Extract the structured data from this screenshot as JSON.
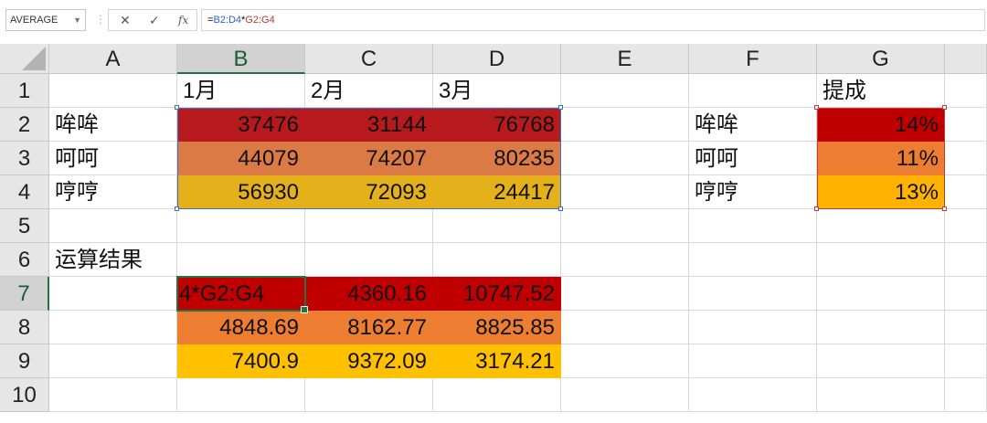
{
  "name_box": {
    "value": "AVERAGE"
  },
  "formula_bar": {
    "cancel_glyph": "✕",
    "enter_glyph": "✓",
    "fx_glyph": "fx",
    "formula_prefix": "=",
    "ref1": "B2:D4",
    "operator": "*",
    "ref2": "G2:G4"
  },
  "columns": [
    "A",
    "B",
    "C",
    "D",
    "E",
    "F",
    "G"
  ],
  "rows": [
    "1",
    "2",
    "3",
    "4",
    "5",
    "6",
    "7",
    "8",
    "9",
    "10"
  ],
  "cells": {
    "B1": "1月",
    "C1": "2月",
    "D1": "3月",
    "G1": "提成",
    "A2": "哞哞",
    "B2": "37476",
    "C2": "31144",
    "D2": "76768",
    "F2": "哞哞",
    "G2": "14%",
    "A3": "呵呵",
    "B3": "44079",
    "C3": "74207",
    "D3": "80235",
    "F3": "呵呵",
    "G3": "11%",
    "A4": "哼哼",
    "B4": "56930",
    "C4": "72093",
    "D4": "24417",
    "F4": "哼哼",
    "G4": "13%",
    "A6": "运算结果",
    "B7": "4*G2:G4",
    "C7": "4360.16",
    "D7": "10747.52",
    "B8": "4848.69",
    "C8": "8162.77",
    "D8": "8825.85",
    "B9": "7400.9",
    "C9": "9372.09",
    "D9": "3174.21"
  },
  "colors": {
    "row2_fill": "#b61a1c",
    "row3_fill": "#dc7a45",
    "row4_fill": "#e5b11a",
    "g2_fill": "#c00000",
    "g3_fill": "#ed7d31",
    "g4_fill": "#ffb300",
    "row7_fill": "#c00000",
    "row8_fill": "#ed7d31",
    "row9_fill": "#ffc000",
    "ref1_border": "#3a6ec7",
    "ref2_border": "#c23b3b",
    "active_border": "#217346"
  },
  "selection": {
    "active_cell": "B7",
    "active_column": "B",
    "active_row": "7"
  }
}
